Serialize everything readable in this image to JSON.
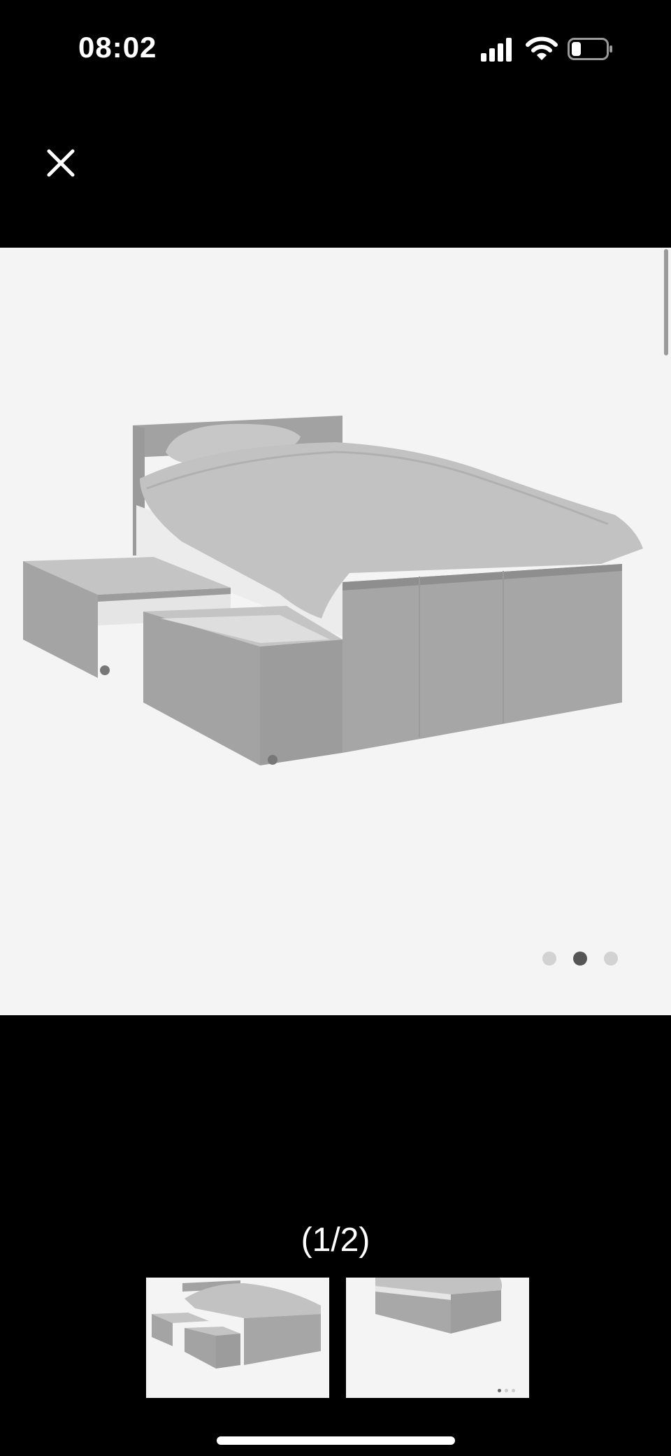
{
  "status_bar": {
    "time": "08:02",
    "icons": [
      "cellular-signal-icon",
      "wifi-icon",
      "battery-icon"
    ]
  },
  "viewer": {
    "close_icon": "close-icon",
    "carousel_dots": {
      "count": 3,
      "active_index": 1
    },
    "counter_text": "(1/2)",
    "thumbnails": [
      {
        "name": "bed-with-drawers-open",
        "selected": true
      },
      {
        "name": "bed-side-view",
        "selected": false
      }
    ]
  },
  "colors": {
    "background": "#000000",
    "image_background": "#f4f4f4",
    "accent": "#ffffff"
  }
}
